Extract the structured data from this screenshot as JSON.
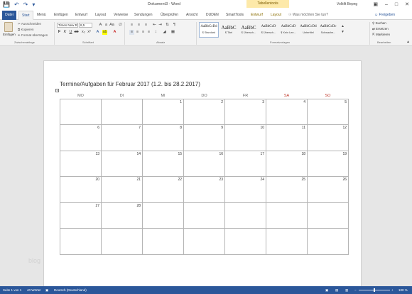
{
  "window": {
    "doc_title": "Dokument3  -  Word",
    "context_group": "Tabellentools",
    "user": "Volkfit Bepng",
    "qat": [
      "save-icon",
      "undo-icon",
      "redo-icon",
      "more-icon"
    ]
  },
  "tabs": {
    "file": "Datei",
    "items": [
      "Start",
      "Menü",
      "Einfügen",
      "Entwurf",
      "Layout",
      "Verweise",
      "Sendungen",
      "Überprüfen",
      "Ansicht",
      "DUDEN",
      "SmartTools",
      "Entwurf",
      "Layout"
    ],
    "tell_me": "Was möchten Sie tun?",
    "share": "Freigeben"
  },
  "ribbon": {
    "clipboard": {
      "paste": "Einfügen",
      "cut": "Ausschneiden",
      "copy": "Kopieren",
      "format_painter": "Format übertragen",
      "label": "Zwischenablage"
    },
    "font": {
      "name": "Times New R",
      "size": "8,5",
      "label": "Schriftart"
    },
    "paragraph": {
      "label": "Absatz"
    },
    "styles": {
      "label": "Formatvorlagen",
      "items": [
        {
          "sample": "AaBbCcDd",
          "name": "¶ Standard"
        },
        {
          "sample": "AaBbC",
          "name": "¶ Titel"
        },
        {
          "sample": "AaBbC",
          "name": "¶ Übersch..."
        },
        {
          "sample": "AaBbCcD",
          "name": "¶ Übersch..."
        },
        {
          "sample": "AaBbCcD",
          "name": "¶ Kein Lee..."
        },
        {
          "sample": "AaBbCcDd",
          "name": "Untertitel"
        },
        {
          "sample": "AaBbCcDc",
          "name": "Schwache..."
        }
      ]
    },
    "editing": {
      "find": "Suchen",
      "replace": "Ersetzen",
      "select": "Markieren",
      "label": "Bearbeiten"
    }
  },
  "document": {
    "heading": "Termine/Aufgaben für Februar 2017 (1.2. bis 28.2.2017)",
    "weekdays": [
      "MO",
      "DI",
      "MI",
      "DO",
      "FR",
      "SA",
      "SO"
    ],
    "weeks": [
      [
        "",
        "",
        "1",
        "2",
        "3",
        "4",
        "5"
      ],
      [
        "6",
        "7",
        "8",
        "9",
        "10",
        "11",
        "12"
      ],
      [
        "13",
        "14",
        "15",
        "16",
        "17",
        "18",
        "19"
      ],
      [
        "20",
        "21",
        "22",
        "23",
        "24",
        "25",
        "26"
      ],
      [
        "27",
        "28",
        "",
        "",
        "",
        "",
        ""
      ],
      [
        "",
        "",
        "",
        "",
        "",
        "",
        ""
      ]
    ],
    "watermark": "blog"
  },
  "status": {
    "page": "Seite 1 von 1",
    "words": "40 Wörter",
    "language": "Deutsch (Deutschland)",
    "zoom": "100 %"
  },
  "colors": {
    "accent": "#2b579a",
    "weekend": "#c0392b",
    "context_tab": "#fde9a9"
  }
}
